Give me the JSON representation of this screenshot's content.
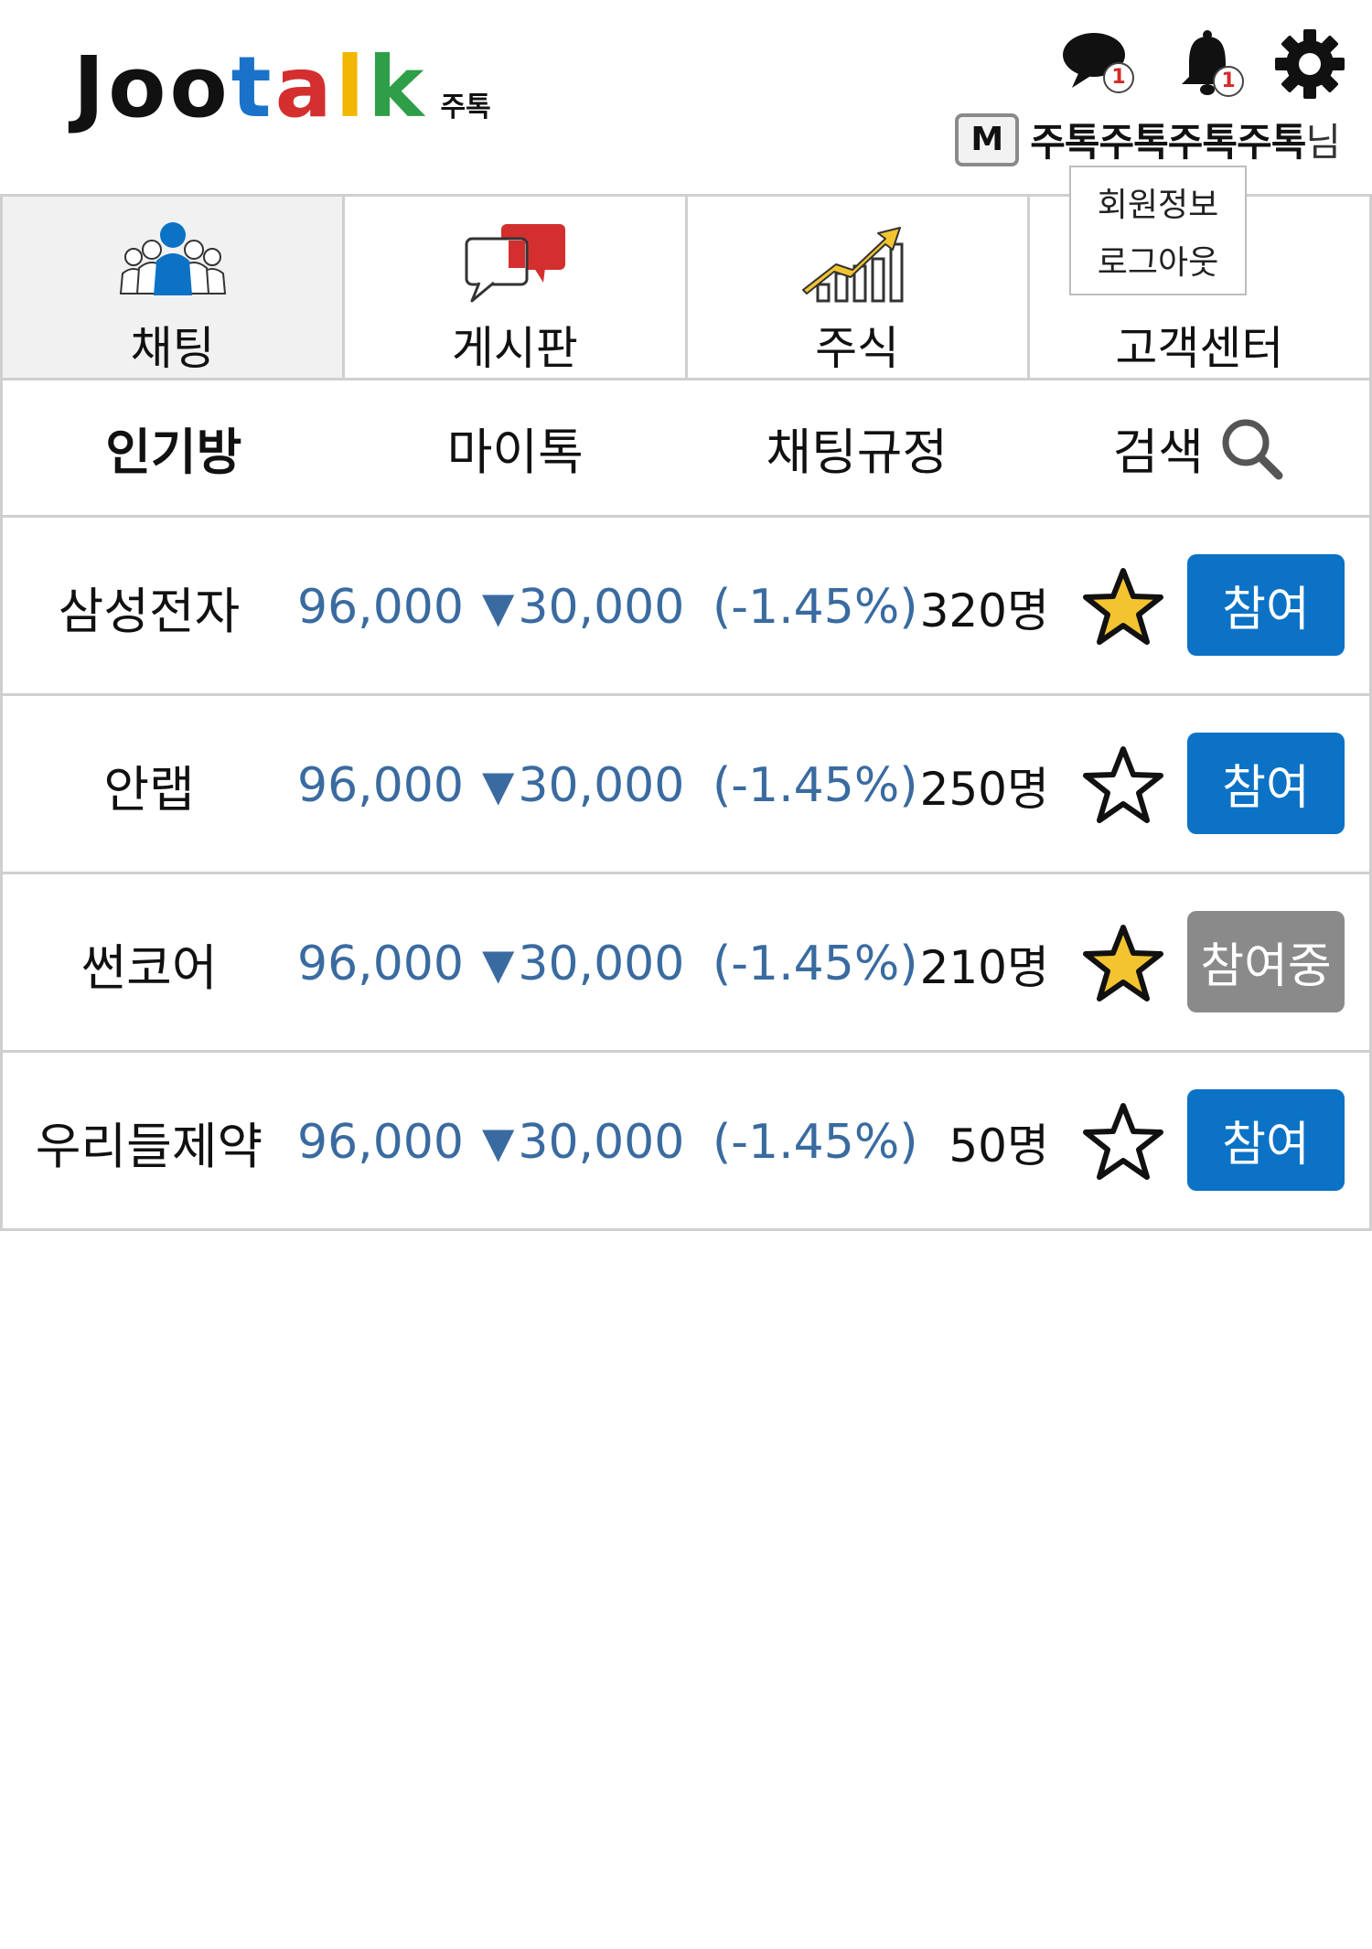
{
  "header": {
    "logo_letters": [
      {
        "ch": "J",
        "color": "#111111"
      },
      {
        "ch": "o",
        "color": "#111111"
      },
      {
        "ch": "o",
        "color": "#111111"
      },
      {
        "ch": "t",
        "color": "#1a73c9"
      },
      {
        "ch": "a",
        "color": "#d32f2f"
      },
      {
        "ch": "l",
        "color": "#f2b705"
      },
      {
        "ch": "k",
        "color": "#2e9e48"
      }
    ],
    "logo_sub": "주톡",
    "chat_badge": "1",
    "notif_badge": "1",
    "user_level": "M",
    "user_name": "주톡주톡주톡주톡",
    "user_suffix": "님"
  },
  "dropdown": {
    "items": [
      "회원정보",
      "로그아웃"
    ]
  },
  "main_tabs": [
    {
      "label": "채팅",
      "icon": "users-icon"
    },
    {
      "label": "게시판",
      "icon": "speech-bubbles-icon"
    },
    {
      "label": "주식",
      "icon": "rising-chart-icon"
    },
    {
      "label": "고객센터",
      "icon": "support-icon"
    }
  ],
  "sub_tabs": [
    "인기방",
    "마이톡",
    "채팅규정",
    "검색"
  ],
  "rooms": [
    {
      "name": "삼성전자",
      "price": "96,000",
      "change": "30,000",
      "change_icon": "down-triangle-icon",
      "pct": "(-1.45%)",
      "count": "320명",
      "favorite": true,
      "button": "참여",
      "button_state": "join"
    },
    {
      "name": "안랩",
      "price": "96,000",
      "change": "30,000",
      "change_icon": "down-triangle-icon",
      "pct": "(-1.45%)",
      "count": "250명",
      "favorite": false,
      "button": "참여",
      "button_state": "join"
    },
    {
      "name": "썬코어",
      "price": "96,000",
      "change": "30,000",
      "change_icon": "down-triangle-icon",
      "pct": "(-1.45%)",
      "count": "210명",
      "favorite": true,
      "button": "참여중",
      "button_state": "joined"
    },
    {
      "name": "우리들제약",
      "price": "96,000",
      "change": "30,000",
      "change_icon": "down-triangle-icon",
      "pct": "(-1.45%)",
      "count": "50명",
      "favorite": false,
      "button": "참여",
      "button_state": "join"
    }
  ],
  "colors": {
    "accent_blue": "#0b72c6",
    "joined_gray": "#8a8a8a",
    "stock_blue": "#3a6ba0",
    "star_gold": "#f4c430"
  }
}
